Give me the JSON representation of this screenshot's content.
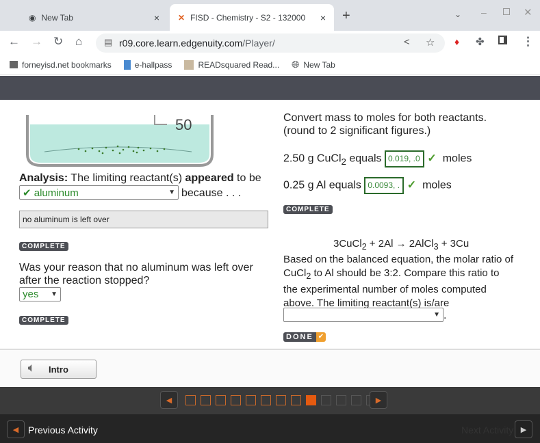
{
  "browser": {
    "tabs": [
      {
        "title": "New Tab",
        "close": "×"
      },
      {
        "title": "FISD - Chemistry - S2 - 132000 - ",
        "close": "×"
      }
    ],
    "new_tab": "+",
    "url_host": "r09.core.learn.edgenuity.com",
    "url_path": "/Player/",
    "bookmarks": [
      "forneyisd.net bookmarks",
      "e-hallpass",
      "READsquared Read...",
      "New Tab"
    ]
  },
  "left": {
    "beaker_mark": "50",
    "analysis_label": "Analysis:",
    "analysis_text1": " The limiting reactant(s) ",
    "analysis_bold": "appeared",
    "analysis_text2": " to be",
    "limiting_select": "✔ aluminum",
    "because": "because . . .",
    "reason_value": "no aluminum is left over",
    "complete1": "COMPLETE",
    "question": "Was your reason that no aluminum was left over after the reaction stopped?",
    "yes_select": "yes",
    "complete2": "COMPLETE"
  },
  "right": {
    "instr1": "Convert mass to moles for both reactants.",
    "instr2": "(round to 2 significant figures.)",
    "cucl2_pre": "2.50 g CuCl",
    "cucl2_sub": "2",
    "cucl2_post": " equals",
    "cucl2_value": "0.019, .0",
    "moles": "moles",
    "al_pre": "0.25 g Al equals",
    "al_value": "0.0093, .",
    "check": "✓",
    "complete": "COMPLETE",
    "eq": {
      "a": "3CuCl",
      "a_sub": "2",
      "b": " + 2Al ",
      "arrow": "→",
      "c": " 2AlCl",
      "c_sub": "3",
      "d": " + 3Cu"
    },
    "para1": "Based on the balanced equation, the molar ratio of",
    "para2a": "CuCl",
    "para2sub": "2",
    "para2b": " to Al should be 3:2. Compare this ratio to",
    "para3": "the experimental number of moles computed",
    "para4": "above. The limiting reactant(s) is/are",
    "period": ".",
    "done": "DONE"
  },
  "bottom": {
    "intro": "Intro",
    "pages_total": 13,
    "current_page": 9,
    "prev": "Previous Activity",
    "next": "Next Activity"
  },
  "colors": {
    "accent": "#e55a10",
    "correct": "#2a8a2a",
    "header": "#4a4c55"
  }
}
